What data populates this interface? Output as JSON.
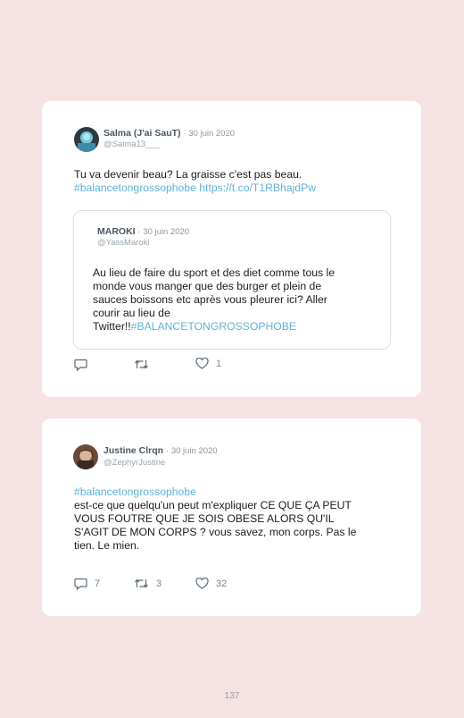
{
  "tweets": [
    {
      "name": "Salma (J'ai SauT)",
      "date": "· 30 juin 2020",
      "handle": "@Salma13___",
      "text_plain": "Tu va devenir beau? La graisse c'est pas beau.",
      "hashtag": "#balancetongrossophobe",
      "url": "https://t.co/T1RBhajdPw",
      "quote": {
        "name": "MAROKI",
        "date": "· 30 juin 2020",
        "handle": "@YassMaroki",
        "line1": "Au lieu de faire du sport et des diet comme tous le",
        "line2": "monde vous manger que des burger et plein de",
        "line3": "sauces boissons etc après vous pleurer ici? Aller",
        "line4": "courir au lieu de",
        "line5_plain": "Twitter!!",
        "line5_hashtag": "#BALANCETONGROSSOPHOBE"
      },
      "actions": {
        "replies": "",
        "retweets": "",
        "likes": "1"
      }
    },
    {
      "name": "Justine Clrqn",
      "date": "· 30 juin 2020",
      "handle": "@ZephyrJustine",
      "hashtag": "#balancetongrossophobe",
      "line1": "est-ce que quelqu'un peut m'expliquer CE QUE ÇA PEUT",
      "line2": "VOUS FOUTRE QUE JE SOIS OBESE ALORS QU'IL",
      "line3": "S'AGIT DE MON CORPS ? vous savez, mon corps. Pas le",
      "line4": "tien. Le mien.",
      "actions": {
        "replies": "7",
        "retweets": "3",
        "likes": "32"
      }
    }
  ],
  "page_number": "137",
  "colors": {
    "background": "#f5e3e3",
    "link": "#5fb2d9",
    "card": "#ffffff"
  },
  "icons": [
    "reply-icon",
    "retweet-icon",
    "like-icon"
  ]
}
